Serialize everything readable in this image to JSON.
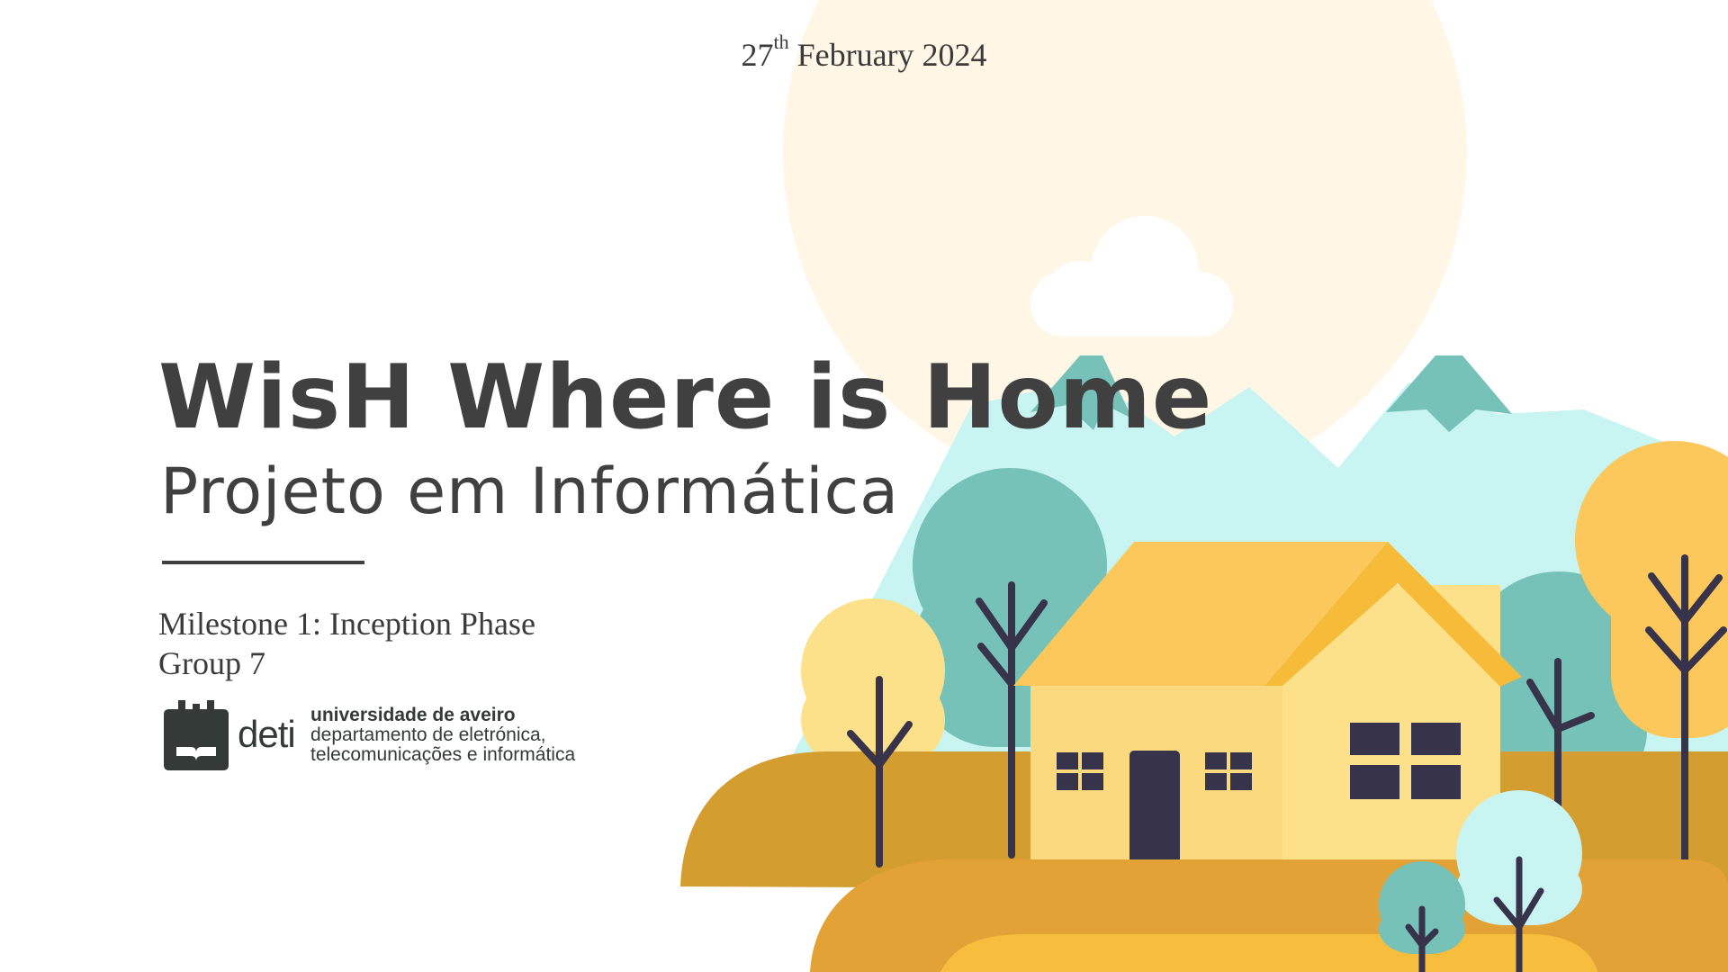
{
  "slide": {
    "date_day": "27",
    "date_suffix": "th",
    "date_rest": "February 2024",
    "title": "WisH Where is Home",
    "subtitle": "Projeto em Informática",
    "milestone": "Milestone 1: Inception Phase",
    "group": "Group 7"
  },
  "logo": {
    "deti": "deti",
    "line1": "universidade de aveiro",
    "line2": "departamento de eletrónica,",
    "line3": "telecomunicações e informática"
  },
  "colors": {
    "text": "#404040",
    "sun": "#fff6e6",
    "mountain": "#c8f4f1",
    "teal": "#76c1b8",
    "roof": "#fcc85c",
    "house": "#fbd97e",
    "ground": "#d8a032",
    "dark": "#37334a"
  }
}
